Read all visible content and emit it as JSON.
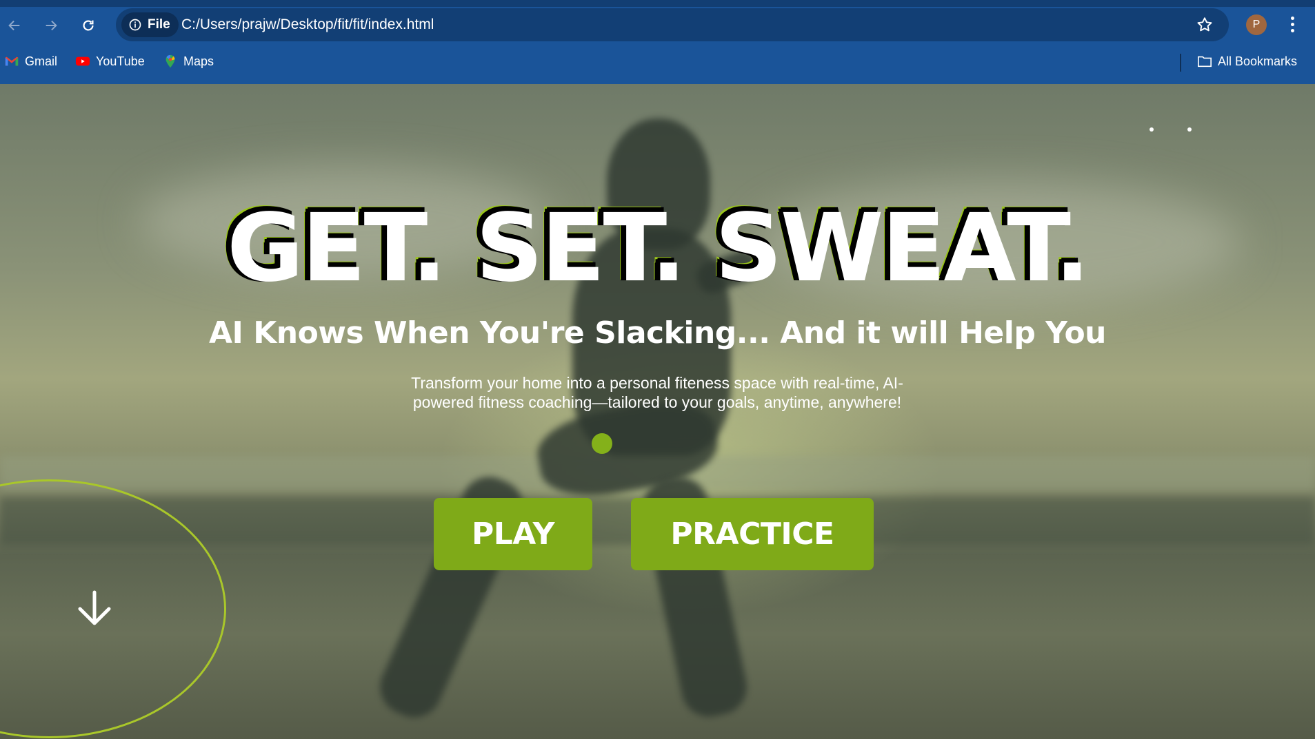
{
  "browser": {
    "url_chip_label": "File",
    "url": "C:/Users/prajw/Desktop/fit/fit/index.html",
    "profile_initial": "P",
    "bookmarks": [
      {
        "label": "Gmail",
        "icon": "gmail-icon"
      },
      {
        "label": "YouTube",
        "icon": "youtube-icon"
      },
      {
        "label": "Maps",
        "icon": "maps-icon"
      }
    ],
    "all_bookmarks_label": "All Bookmarks"
  },
  "hero": {
    "headline": "GET. SET. SWEAT.",
    "subheadline": "AI Knows When You're Slacking... And it will Help You",
    "description": "Transform your home into a personal fiteness space with real-time, AI-powered fitness coaching—tailored to your goals, anytime, anywhere!",
    "buttons": {
      "play": "PLAY",
      "practice": "PRACTICE"
    },
    "scroll_icon": "arrow-down-icon"
  },
  "colors": {
    "browser_chrome": "#1a5499",
    "omnibox": "#123f75",
    "accent_green": "#7faa18",
    "circle_outline": "#a9c72a"
  }
}
